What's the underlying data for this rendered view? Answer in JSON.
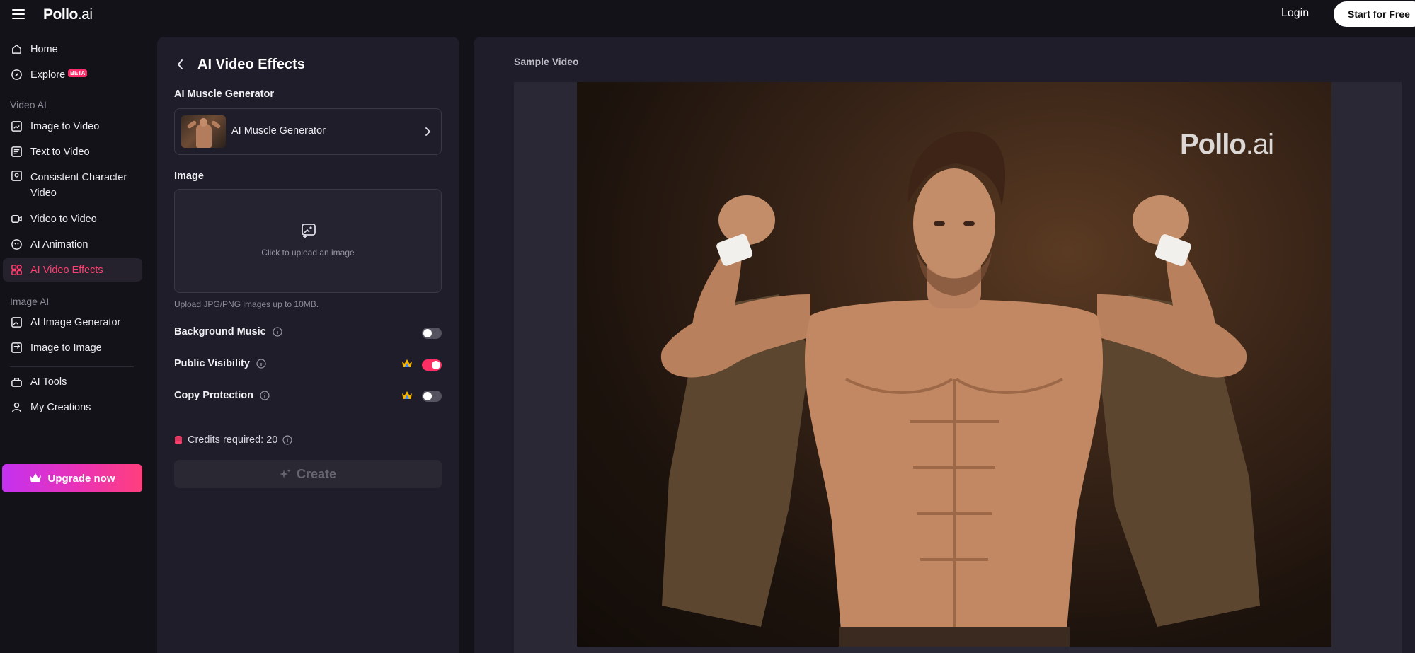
{
  "header": {
    "logo_main": "Pollo",
    "logo_suffix": ".ai",
    "login": "Login",
    "start_button": "Start for Free"
  },
  "sidebar": {
    "home": "Home",
    "explore": "Explore",
    "explore_badge": "BETA",
    "section_video": "Video AI",
    "image_to_video": "Image to Video",
    "text_to_video": "Text to Video",
    "consistent_character_line1": "Consistent Character",
    "consistent_character_line2": "Video",
    "video_to_video": "Video to Video",
    "ai_animation": "AI Animation",
    "ai_video_effects": "AI Video Effects",
    "section_image": "Image AI",
    "ai_image_generator": "AI Image Generator",
    "image_to_image": "Image to Image",
    "ai_tools": "AI Tools",
    "my_creations": "My Creations",
    "upgrade": "Upgrade now"
  },
  "panel": {
    "title": "AI Video Effects",
    "effect_label": "AI Muscle Generator",
    "effect_selected": "AI Muscle Generator",
    "image_label": "Image",
    "upload_text": "Click to upload an image",
    "upload_hint": "Upload JPG/PNG images up to 10MB.",
    "options": {
      "background_music": {
        "label": "Background Music",
        "on": false
      },
      "public_visibility": {
        "label": "Public Visibility",
        "on": true
      },
      "copy_protection": {
        "label": "Copy Protection",
        "on": false
      }
    },
    "credits_text": "Credits required: 20",
    "create": "Create"
  },
  "preview": {
    "label": "Sample Video",
    "watermark_main": "Pollo",
    "watermark_suffix": ".ai"
  },
  "colors": {
    "accent": "#ff3f6e",
    "toggle_on": "#ff2f63",
    "upgrade_gradient": [
      "#c431f0",
      "#ff3f7d"
    ]
  }
}
